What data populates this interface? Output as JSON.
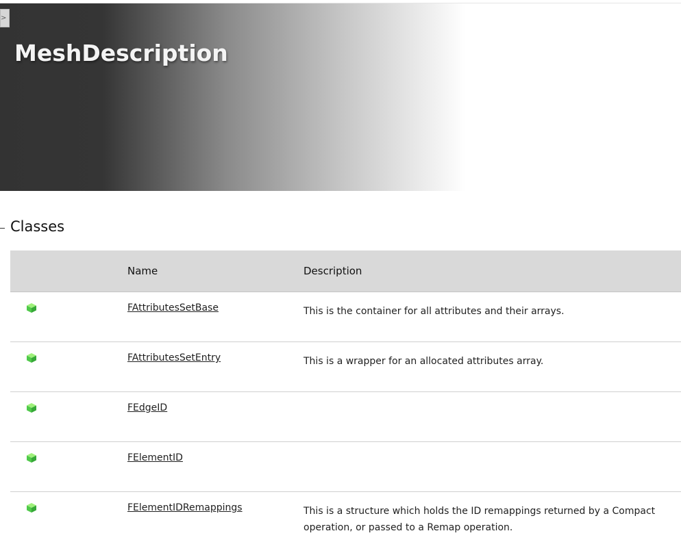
{
  "page": {
    "title": "MeshDescription",
    "toggle_label": ">"
  },
  "section": {
    "title": "Classes"
  },
  "table": {
    "headers": {
      "name": "Name",
      "description": "Description"
    },
    "rows": [
      {
        "icon": "class-cube-icon",
        "name": "FAttributesSetBase",
        "description": "This is the container for all attributes and their arrays."
      },
      {
        "icon": "class-cube-icon",
        "name": "FAttributesSetEntry",
        "description": "This is a wrapper for an allocated attributes array."
      },
      {
        "icon": "class-cube-icon",
        "name": "FEdgeID",
        "description": ""
      },
      {
        "icon": "class-cube-icon",
        "name": "FElementID",
        "description": ""
      },
      {
        "icon": "class-cube-icon",
        "name": "FElementIDRemappings",
        "description": "This is a structure which holds the ID remappings returned by a Compact operation, or passed to a Remap operation."
      }
    ]
  },
  "colors": {
    "icon_green": "#5fd35a",
    "header_bg": "#d9d9d9"
  }
}
